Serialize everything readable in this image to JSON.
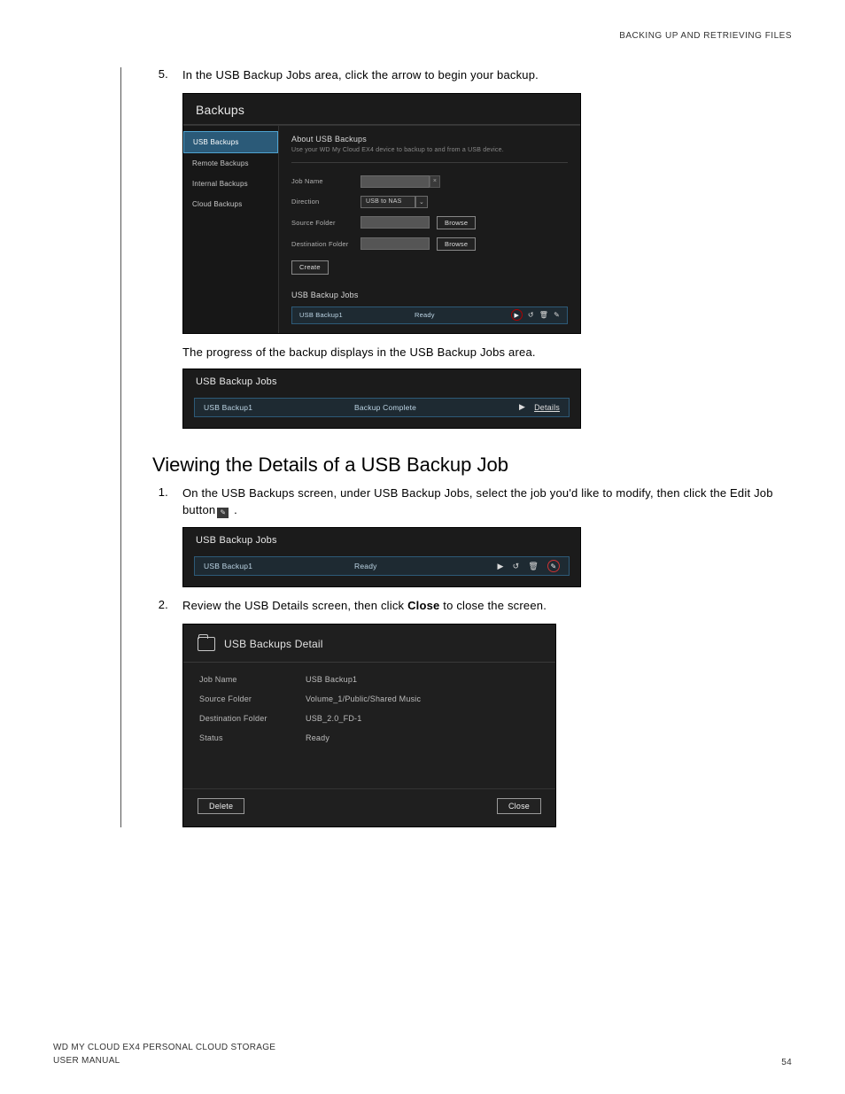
{
  "header": {
    "section": "BACKING UP AND RETRIEVING FILES"
  },
  "steps": {
    "s5": {
      "num": "5.",
      "text": "In the USB Backup Jobs area, click the arrow to begin your backup."
    },
    "s5b": "The progress of the backup displays in the USB Backup Jobs area.",
    "section_title": "Viewing the Details of a USB Backup Job",
    "s1": {
      "num": "1.",
      "text_a": "On the USB Backups screen, under USB Backup Jobs, select the job you'd like to modify, then click the Edit Job button",
      "text_b": " ."
    },
    "s2": {
      "num": "2.",
      "text_a": "Review the USB Details screen, then click ",
      "bold": "Close",
      "text_b": " to close the screen."
    }
  },
  "ss1": {
    "title": "Backups",
    "sidebar": {
      "usb": "USB Backups",
      "remote": "Remote Backups",
      "internal": "Internal Backups",
      "cloud": "Cloud Backups"
    },
    "about_h": "About USB Backups",
    "about_sub": "Use your WD My Cloud EX4 device to backup to and from a USB device.",
    "labels": {
      "job": "Job Name",
      "dir": "Direction",
      "src": "Source Folder",
      "dst": "Destination Folder"
    },
    "dir_value": "USB to NAS",
    "browse": "Browse",
    "create": "Create",
    "jobs_h": "USB Backup Jobs",
    "job_name": "USB Backup1",
    "job_status": "Ready"
  },
  "ss2": {
    "title": "USB Backup Jobs",
    "name": "USB Backup1",
    "status": "Backup Complete",
    "details": "Details"
  },
  "ss3": {
    "title": "USB Backup Jobs",
    "name": "USB Backup1",
    "status": "Ready"
  },
  "ss4": {
    "title": "USB Backups Detail",
    "rows": {
      "r1": {
        "label": "Job Name",
        "val": "USB Backup1"
      },
      "r2": {
        "label": "Source Folder",
        "val": "Volume_1/Public/Shared Music"
      },
      "r3": {
        "label": "Destination Folder",
        "val": "USB_2.0_FD-1"
      },
      "r4": {
        "label": "Status",
        "val": "Ready"
      }
    },
    "delete": "Delete",
    "close": "Close"
  },
  "footer": {
    "line1": "WD MY CLOUD EX4 PERSONAL CLOUD STORAGE",
    "line2": "USER MANUAL",
    "page": "54"
  }
}
